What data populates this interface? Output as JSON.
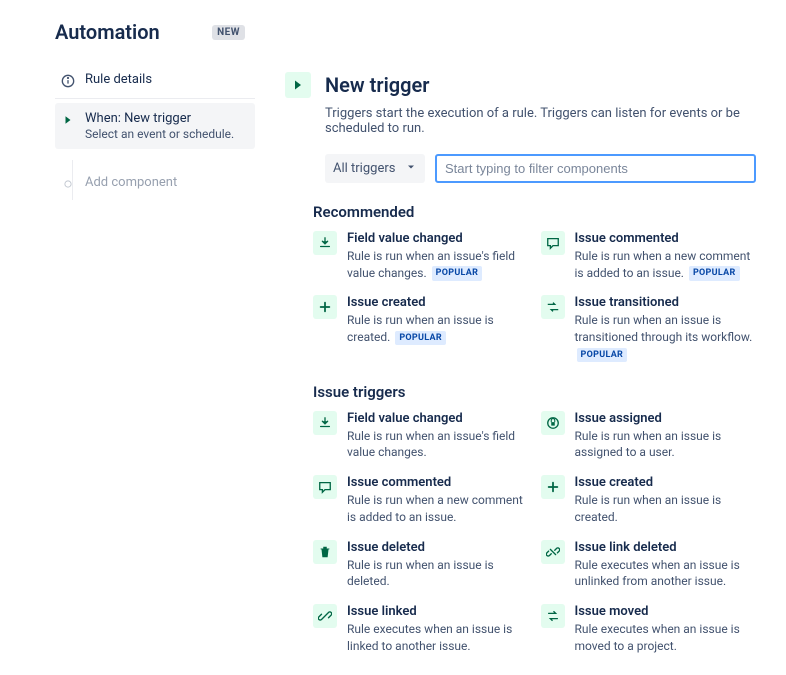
{
  "header": {
    "title": "Automation",
    "badge": "NEW"
  },
  "sidebar": {
    "ruleDetails": "Rule details",
    "when": {
      "title": "When: New trigger",
      "subtitle": "Select an event or schedule."
    },
    "addComponent": "Add component"
  },
  "content": {
    "title": "New trigger",
    "description": "Triggers start the execution of a rule. Triggers can listen for events or be scheduled to run.",
    "dropdown": "All triggers",
    "searchPlaceholder": "Start typing to filter components"
  },
  "sections": [
    {
      "title": "Recommended",
      "items": [
        {
          "icon": "download",
          "title": "Field value changed",
          "desc": "Rule is run when an issue's field value changes.",
          "popular": true
        },
        {
          "icon": "comment",
          "title": "Issue commented",
          "desc": "Rule is run when a new comment is added to an issue.",
          "popular": true
        },
        {
          "icon": "plus",
          "title": "Issue created",
          "desc": "Rule is run when an issue is created.",
          "popular": true
        },
        {
          "icon": "transition",
          "title": "Issue transitioned",
          "desc": "Rule is run when an issue is transitioned through its workflow.",
          "popular": true
        }
      ]
    },
    {
      "title": "Issue triggers",
      "items": [
        {
          "icon": "download",
          "title": "Field value changed",
          "desc": "Rule is run when an issue's field value changes.",
          "popular": false
        },
        {
          "icon": "lock",
          "title": "Issue assigned",
          "desc": "Rule is run when an issue is assigned to a user.",
          "popular": false
        },
        {
          "icon": "comment",
          "title": "Issue commented",
          "desc": "Rule is run when a new comment is added to an issue.",
          "popular": false
        },
        {
          "icon": "plus",
          "title": "Issue created",
          "desc": "Rule is run when an issue is created.",
          "popular": false
        },
        {
          "icon": "trash",
          "title": "Issue deleted",
          "desc": "Rule is run when an issue is deleted.",
          "popular": false
        },
        {
          "icon": "unlink",
          "title": "Issue link deleted",
          "desc": "Rule executes when an issue is unlinked from another issue.",
          "popular": false
        },
        {
          "icon": "link",
          "title": "Issue linked",
          "desc": "Rule executes when an issue is linked to another issue.",
          "popular": false
        },
        {
          "icon": "swap",
          "title": "Issue moved",
          "desc": "Rule executes when an issue is moved to a project.",
          "popular": false
        }
      ]
    }
  ],
  "popularLabel": "POPULAR"
}
